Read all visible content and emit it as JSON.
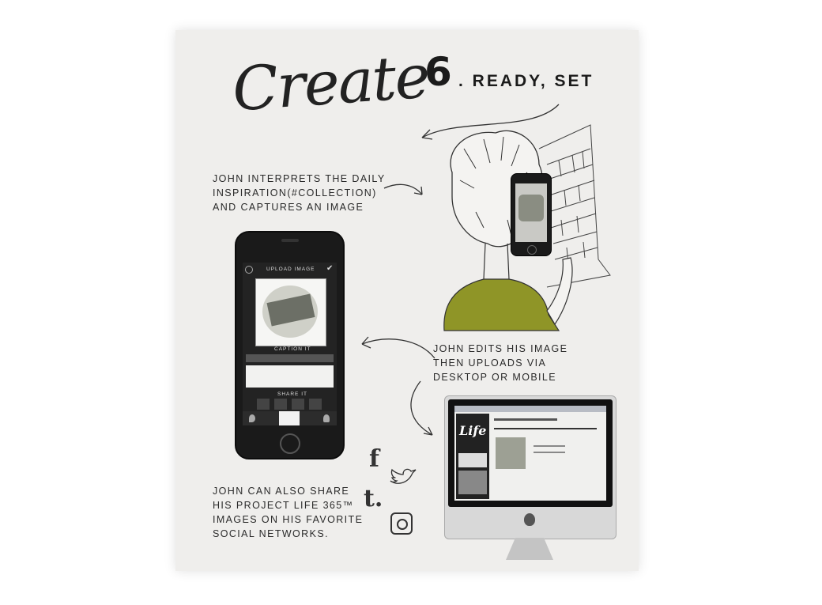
{
  "title": "Create",
  "step": {
    "number": "6",
    "title": ". READY, SET"
  },
  "captions": {
    "interprets": "JOHN INTERPRETS THE DAILY\nINSPIRATION(#COLLECTION)\nAND CAPTURES AN IMAGE",
    "edits": "JOHN EDITS HIS IMAGE\nTHEN UPLOADS VIA\nDESKTOP OR MOBILE",
    "share": "JOHN CAN ALSO SHARE\nHIS PROJECT LIFE 365™\nIMAGES ON HIS FAVORITE\nSOCIAL NETWORKS."
  },
  "phone": {
    "header": "UPLOAD IMAGE",
    "caption_label": "CAPTION IT",
    "share_label": "SHARE IT"
  },
  "desktop": {
    "logo": "Life"
  },
  "social": {
    "facebook": "f",
    "tumblr": "t."
  },
  "colors": {
    "background": "#efeeec",
    "shirt": "#8f9527",
    "phone_body": "#1a1a1a"
  }
}
